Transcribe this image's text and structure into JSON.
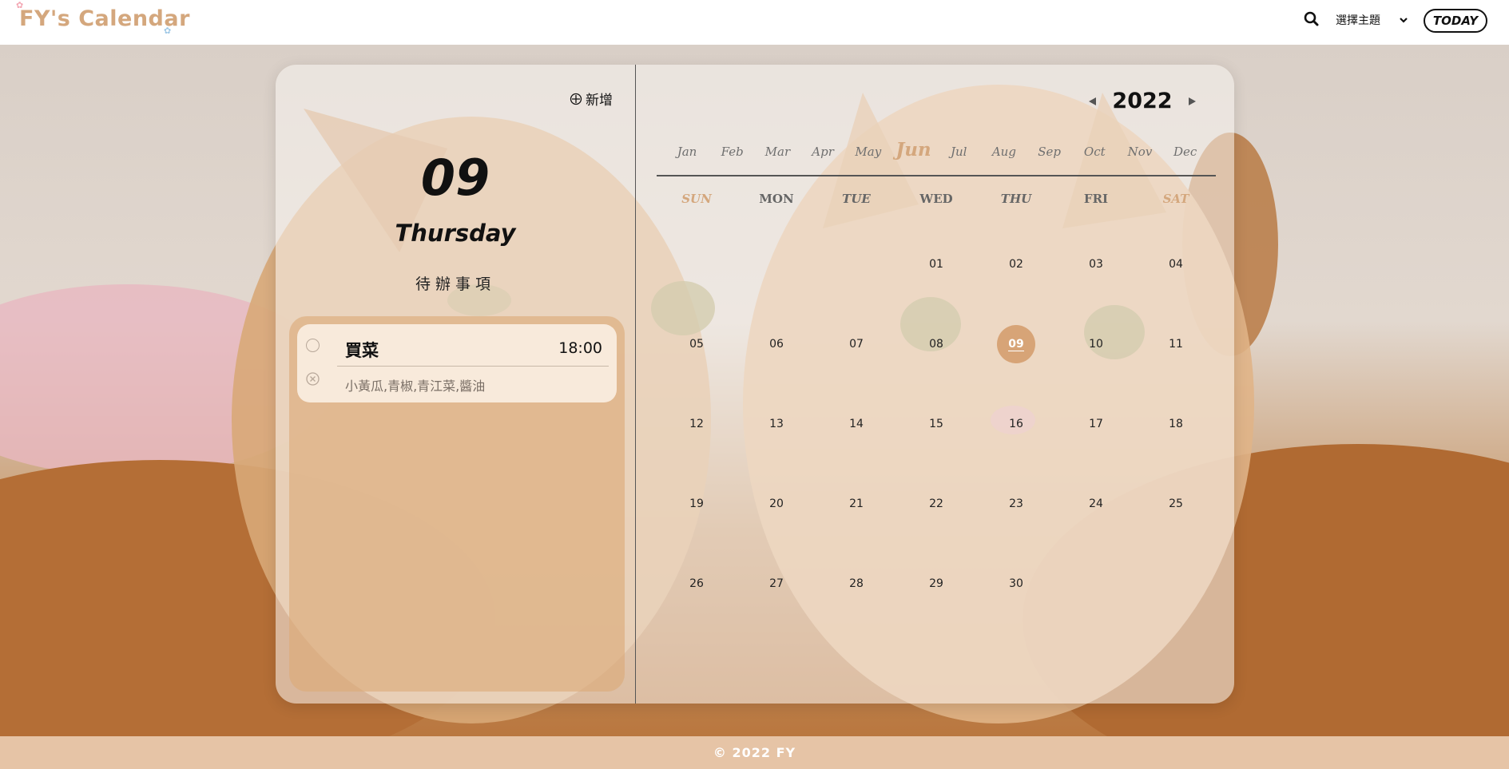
{
  "header": {
    "logo": "FY's Calendar",
    "theme_label": "選擇主題",
    "today_label": "TODAY"
  },
  "icons": {
    "search": "search-icon",
    "chevron": "chevron-down-icon",
    "add": "circle-plus-icon",
    "check": "circle-icon",
    "delete": "circle-x-icon",
    "prev_year": "triangle-left-icon",
    "next_year": "triangle-right-icon",
    "paw": "paw-icon"
  },
  "colors": {
    "accent": "#d4a77d",
    "selected_date": "#d7a477",
    "footer": "#e6c4a6",
    "todo_panel": "#dcaa78"
  },
  "left": {
    "add_label": "新增",
    "day_number": "09",
    "day_name": "Thursday",
    "todo_title": "待辦事項",
    "todos": [
      {
        "name": "買菜",
        "time": "18:00",
        "note": "小黃瓜,青椒,青江菜,醬油"
      }
    ]
  },
  "calendar": {
    "year": "2022",
    "months": [
      "Jan",
      "Feb",
      "Mar",
      "Apr",
      "May",
      "Jun",
      "Jul",
      "Aug",
      "Sep",
      "Oct",
      "Nov",
      "Dec"
    ],
    "active_month_index": 5,
    "weekdays": [
      "SUN",
      "MON",
      "TUE",
      "WED",
      "THU",
      "FRI",
      "SAT"
    ],
    "first_weekday_index": 3,
    "days_in_month": 30,
    "selected_day": "09"
  },
  "footer": {
    "text": "© 2022 FY"
  }
}
